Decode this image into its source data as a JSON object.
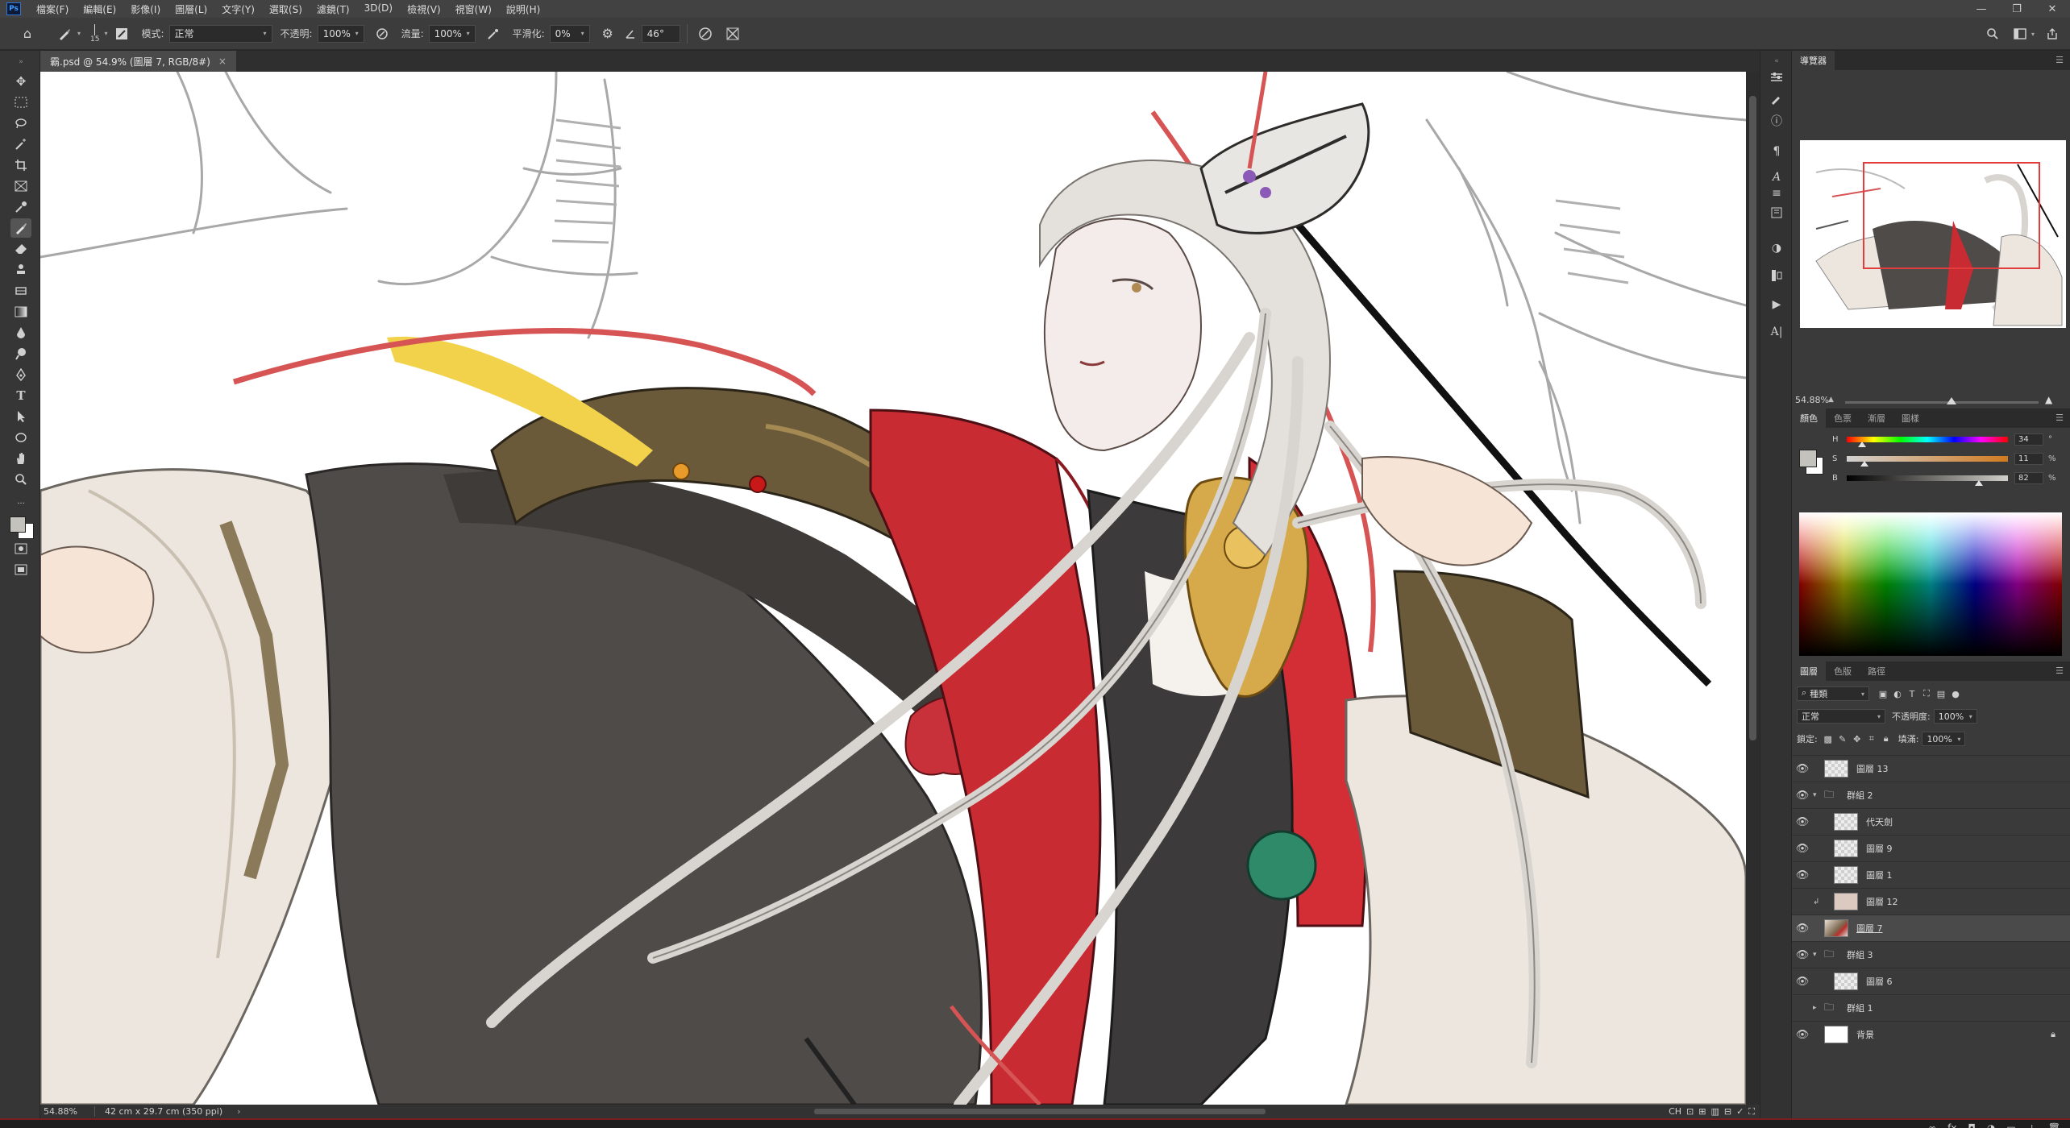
{
  "menu": {
    "logo": "Ps",
    "items": [
      "檔案(F)",
      "編輯(E)",
      "影像(I)",
      "圖層(L)",
      "文字(Y)",
      "選取(S)",
      "濾鏡(T)",
      "3D(D)",
      "檢視(V)",
      "視窗(W)",
      "說明(H)"
    ],
    "window_controls": [
      "—",
      "❐",
      "✕"
    ]
  },
  "options": {
    "brush_size": "15",
    "mode_label": "模式:",
    "mode_value": "正常",
    "opacity_label": "不透明:",
    "opacity_value": "100%",
    "flow_label": "流量:",
    "flow_value": "100%",
    "smoothing_label": "平滑化:",
    "smoothing_value": "0%",
    "angle_value": "46°"
  },
  "document": {
    "tab_title": "霸.psd @ 54.9% (圖層 7, RGB/8#)",
    "close": "×"
  },
  "status": {
    "zoom": "54.88%",
    "doc_info": "42 cm x 29.7 cm (350 ppi)",
    "arrow": "›",
    "icons": [
      "CH",
      "⊡",
      "⊞",
      "▥",
      "⊟",
      "✓",
      "⛶"
    ]
  },
  "navigator": {
    "tab": "導覽器",
    "zoom": "54.88%",
    "zoom_fraction": 0.55
  },
  "color": {
    "tabs": [
      "顏色",
      "色票",
      "漸層",
      "圖樣"
    ],
    "h_label": "H",
    "h_value": "34",
    "h_unit": "°",
    "s_label": "S",
    "s_value": "11",
    "s_unit": "%",
    "b_label": "B",
    "b_value": "82",
    "b_unit": "%",
    "h_fraction": 0.094,
    "s_fraction": 0.11,
    "b_fraction": 0.82,
    "foreground": "#c4c2bd",
    "background": "#ffffff"
  },
  "layers": {
    "tabs": [
      "圖層",
      "色版",
      "路徑"
    ],
    "filter_kind": "種類",
    "blend_mode": "正常",
    "opacity_label": "不透明度:",
    "opacity_value": "100%",
    "lock_label": "鎖定:",
    "fill_label": "填滿:",
    "fill_value": "100%",
    "items": [
      {
        "name": "圖層 13",
        "type": "layer",
        "indent": 0,
        "visible": true
      },
      {
        "name": "群組 2",
        "type": "group",
        "indent": 0,
        "visible": true,
        "open": true
      },
      {
        "name": "代天劍",
        "type": "layer",
        "indent": 1,
        "visible": true
      },
      {
        "name": "圖層 9",
        "type": "layer",
        "indent": 1,
        "visible": true
      },
      {
        "name": "圖層 1",
        "type": "layer",
        "indent": 1,
        "visible": true
      },
      {
        "name": "圖層 12",
        "type": "layer-pink",
        "indent": 1,
        "visible": false
      },
      {
        "name": "圖層 7",
        "type": "layer-art",
        "indent": 0,
        "visible": true,
        "selected": true
      },
      {
        "name": "群組 3",
        "type": "group",
        "indent": 0,
        "visible": true,
        "open": true
      },
      {
        "name": "圖層 6",
        "type": "layer",
        "indent": 1,
        "visible": true
      },
      {
        "name": "群組 1",
        "type": "group",
        "indent": 0,
        "visible": false,
        "open": false
      },
      {
        "name": "背景",
        "type": "background",
        "indent": 0,
        "visible": true,
        "locked": true
      }
    ],
    "footer_icons": [
      "∞",
      "fx",
      "◘",
      "◑",
      "▭",
      "＋",
      "🗑"
    ]
  }
}
